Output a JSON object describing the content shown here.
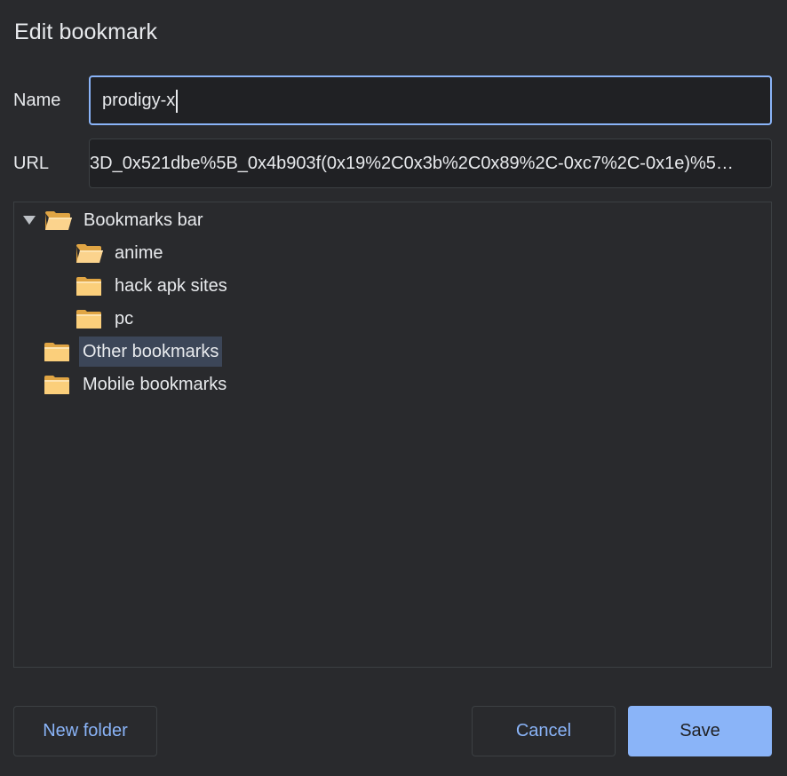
{
  "dialog": {
    "title": "Edit bookmark",
    "name_label": "Name",
    "url_label": "URL",
    "name_value": "prodigy-x",
    "url_value": "3D_0x521dbe%5B_0x4b903f(0x19%2C0x3b%2C0x89%2C-0xc7%2C-0x1e)%5…"
  },
  "tree": {
    "root": {
      "label": "Bookmarks bar",
      "expanded": true
    },
    "children": [
      {
        "label": "anime",
        "open": true
      },
      {
        "label": "hack apk sites",
        "open": false
      },
      {
        "label": "pc",
        "open": false
      }
    ],
    "other": {
      "label": "Other bookmarks",
      "selected": true
    },
    "mobile": {
      "label": "Mobile bookmarks"
    }
  },
  "buttons": {
    "new_folder": "New folder",
    "cancel": "Cancel",
    "save": "Save"
  },
  "colors": {
    "background": "#292a2d",
    "accent": "#8ab4f8",
    "text": "#e8eaed",
    "selection": "#3c4658",
    "folder": "#fbcf7b"
  },
  "icons": {
    "twisty": "triangle-down-icon",
    "folder_open": "folder-open-icon",
    "folder_closed": "folder-icon"
  }
}
